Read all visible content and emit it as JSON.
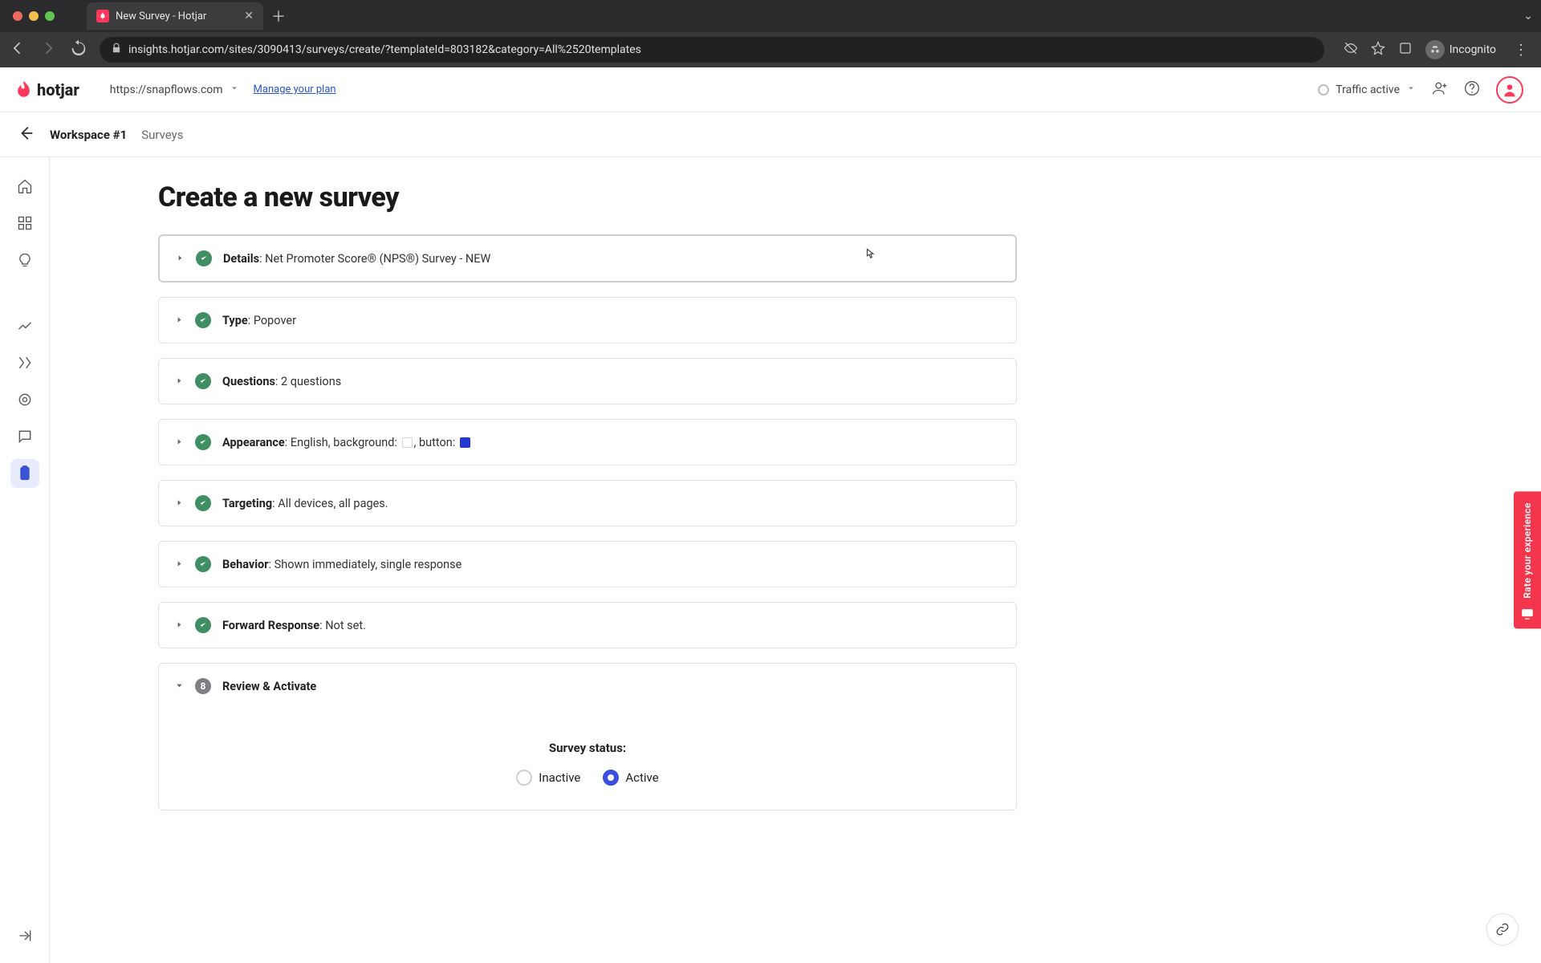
{
  "browser": {
    "tab_title": "New Survey - Hotjar",
    "url_display": "insights.hotjar.com/sites/3090413/surveys/create/?templateId=803182&category=All%2520templates",
    "incognito_label": "Incognito"
  },
  "topbar": {
    "logo_text": "hotjar",
    "site_label": "https://snapflows.com",
    "manage_plan": "Manage your plan",
    "traffic_label": "Traffic active"
  },
  "breadcrumb": {
    "workspace": "Workspace #1",
    "section": "Surveys"
  },
  "page": {
    "title": "Create a new survey"
  },
  "steps": {
    "details": {
      "label": "Details",
      "value": ": Net Promoter Score® (NPS®) Survey - NEW"
    },
    "type": {
      "label": "Type",
      "value": ": Popover"
    },
    "questions": {
      "label": "Questions",
      "value": ": 2 questions"
    },
    "appearance": {
      "label": "Appearance",
      "prefix": ": English, background: ",
      "mid": ", button: "
    },
    "targeting": {
      "label": "Targeting",
      "value": ": All devices, all pages."
    },
    "behavior": {
      "label": "Behavior",
      "value": ": Shown immediately, single response"
    },
    "forward": {
      "label": "Forward Response",
      "value": ": Not set."
    },
    "review": {
      "num": "8",
      "label": "Review & Activate"
    }
  },
  "review": {
    "heading": "Survey status:",
    "inactive": "Inactive",
    "active": "Active"
  },
  "feedback_tab": "Rate your experience"
}
